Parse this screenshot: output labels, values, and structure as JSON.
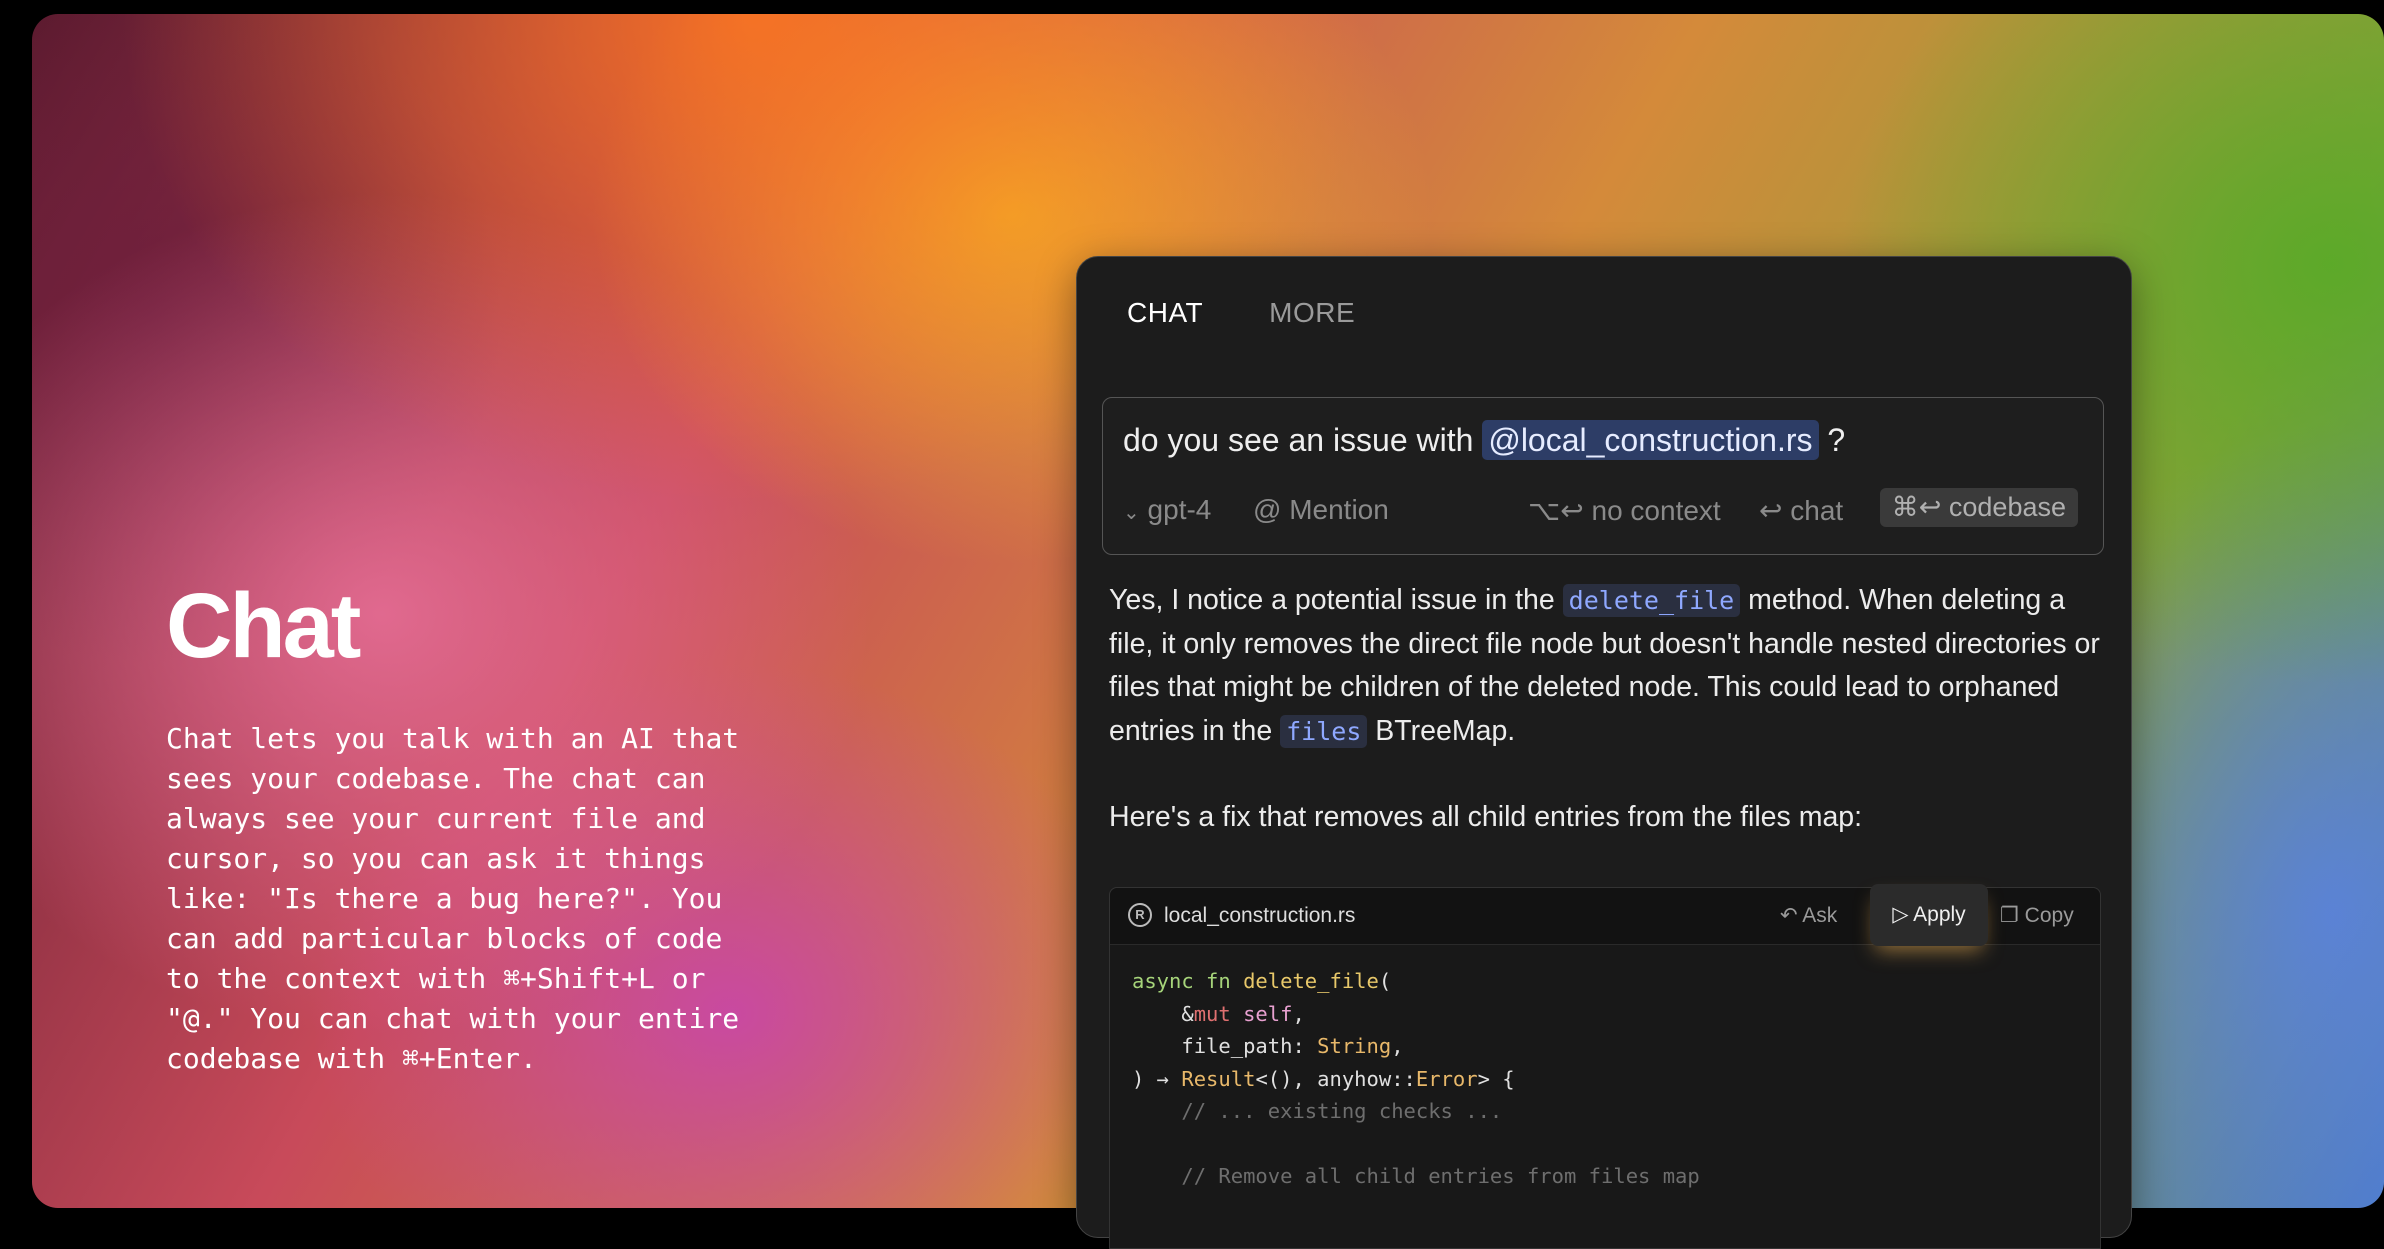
{
  "hero": {
    "title": "Chat",
    "description": "Chat lets you talk with an AI that sees your codebase. The chat can always see your current file and cursor, so you can ask it things like: \"Is there a bug here?\". You can add particular blocks of code to the context with ⌘+Shift+L or \"@.\" You can chat with your entire codebase with ⌘+Enter."
  },
  "panel": {
    "tabs": [
      {
        "label": "CHAT",
        "active": true
      },
      {
        "label": "MORE",
        "active": false
      }
    ],
    "input": {
      "prefix": "do you see an issue with",
      "mention": "@local_construction.rs",
      "suffix": "?",
      "model": "gpt-4",
      "mention_button": "@ Mention",
      "no_context": "⌥↩ no context",
      "chat": "↩ chat",
      "codebase": "⌘↩ codebase"
    },
    "answer": {
      "p1_a": "Yes, I notice a potential issue in the",
      "code1": "delete_file",
      "p1_b": "method. When deleting a file, it only removes the direct file node but doesn't handle nested directories or files that might be children of the deleted node. This could lead to orphaned entries in the",
      "code2": "files",
      "p1_c": "BTreeMap.",
      "p2": "Here's a fix that removes all child entries from the files map:"
    },
    "code": {
      "filename": "local_construction.rs",
      "ask": "Ask",
      "apply": "Apply",
      "copy": "Copy",
      "lines": {
        "l1_kw": "async fn",
        "l1_fn": "delete_file",
        "l1_rest": "(",
        "l2_amp": "&",
        "l2_mut": "mut",
        "l2_self": "self",
        "l2_rest": ",",
        "l3_a": "file_path: ",
        "l3_ty": "String",
        "l3_rest": ",",
        "l4_a": ") → ",
        "l4_ty": "Result",
        "l4_b": "<(), anyhow::",
        "l4_ty2": "Error",
        "l4_c": "> {",
        "l5": "// ... existing checks ...",
        "l7": "// Remove all child entries from files map"
      }
    }
  }
}
